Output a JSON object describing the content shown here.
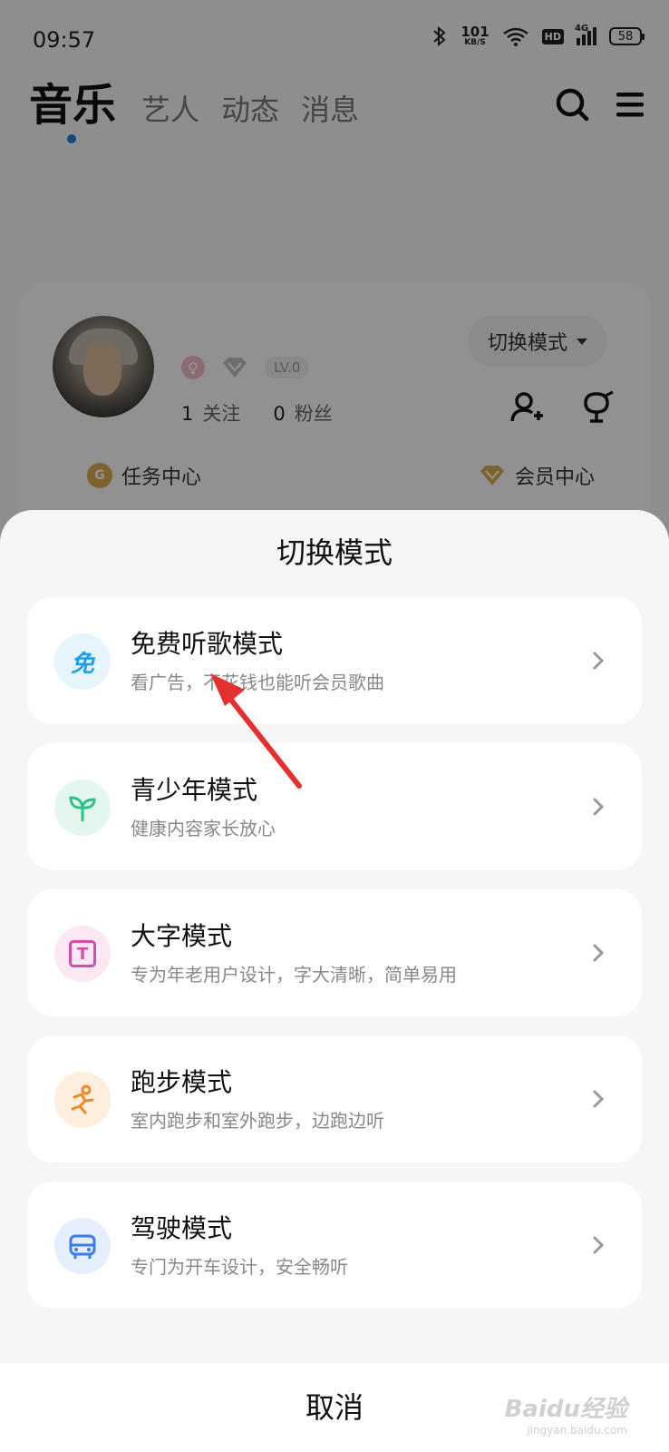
{
  "status_bar": {
    "time": "09:57",
    "net_speed_value": "101",
    "net_speed_unit": "KB/S",
    "hd": "HD",
    "network": "4G",
    "battery": "58"
  },
  "top_nav": {
    "tabs": [
      {
        "label": "音乐",
        "active": true
      },
      {
        "label": "艺人",
        "active": false
      },
      {
        "label": "动态",
        "active": false
      },
      {
        "label": "消息",
        "active": false
      }
    ],
    "icons": [
      "search-icon",
      "menu-icon"
    ]
  },
  "profile": {
    "level": "LV.0",
    "following_count": "1",
    "following_label": "关注",
    "followers_count": "0",
    "followers_label": "粉丝",
    "switch_mode_label": "切换模式",
    "quick_links": [
      {
        "label": "任务中心",
        "icon_text": "G"
      },
      {
        "label": "会员中心"
      }
    ]
  },
  "sheet": {
    "title": "切换模式",
    "items": [
      {
        "title": "免费听歌模式",
        "desc": "看广告，不花钱也能听会员歌曲",
        "icon_text": "免",
        "icon": "free-icon",
        "icon_bg": "#e6f4fc",
        "icon_color": "#1ea0e6"
      },
      {
        "title": "青少年模式",
        "desc": "健康内容家长放心",
        "icon": "sprout-icon",
        "icon_bg": "#e4f7ef",
        "icon_color": "#2ec28a"
      },
      {
        "title": "大字模式",
        "desc": "专为年老用户设计，字大清晰，简单易用",
        "icon_text": "T",
        "icon": "text-size-icon",
        "icon_bg": "#fce8f3",
        "icon_color": "#d84aa8"
      },
      {
        "title": "跑步模式",
        "desc": "室内跑步和室外跑步，边跑边听",
        "icon": "runner-icon",
        "icon_bg": "#fdeedd",
        "icon_color": "#f0882a"
      },
      {
        "title": "驾驶模式",
        "desc": "专门为开车设计，安全畅听",
        "icon": "car-icon",
        "icon_bg": "#e4eefc",
        "icon_color": "#3b7ee6"
      }
    ],
    "cancel": "取消"
  },
  "watermark": {
    "brand": "Baidu经验",
    "url": "jingyan.baidu.com"
  },
  "colors": {
    "accent_blue": "#1e7fd8",
    "annotation_red": "#e53030"
  }
}
